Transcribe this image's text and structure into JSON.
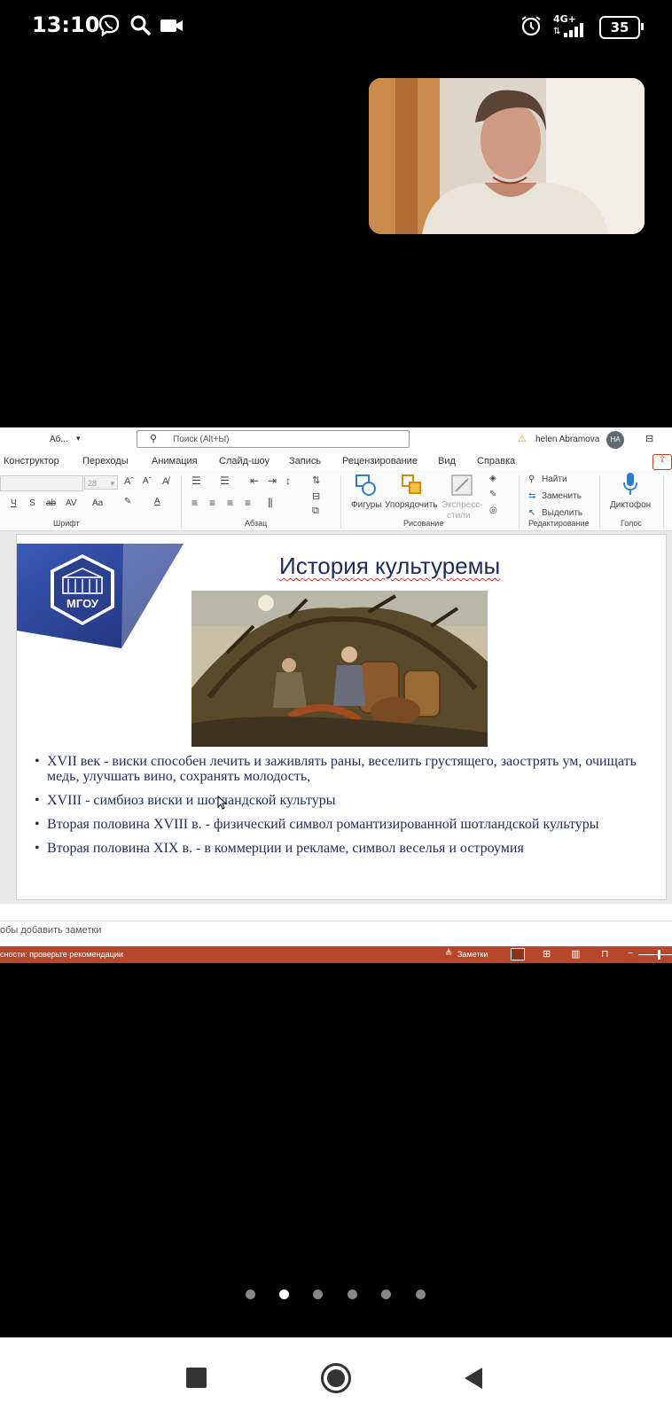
{
  "status_bar": {
    "time": "13:10",
    "network": "4G+",
    "battery": "35",
    "icons": [
      "viber-icon",
      "search-icon",
      "video-camera-icon",
      "alarm-icon",
      "signal-icon",
      "battery-icon"
    ]
  },
  "app_window": {
    "doc_name": "Аб...",
    "search_placeholder": "Поиск (Alt+Ы)",
    "user_name": "helen Abramova",
    "user_initials": "HA"
  },
  "menu_tabs": [
    "Конструктор",
    "Переходы",
    "Анимация",
    "Слайд-шоу",
    "Запись",
    "Рецензирование",
    "Вид",
    "Справка"
  ],
  "ribbon": {
    "font_size": "28",
    "groups": {
      "font": "Шрифт",
      "paragraph": "Абзац",
      "drawing": "Рисование",
      "editing": "Редактирование",
      "voice": "Голос"
    },
    "buttons": {
      "shapes": "Фигуры",
      "arrange": "Упорядочить",
      "express_styles_line1": "Экспресс-",
      "express_styles_line2": "стили",
      "find": "Найти",
      "replace": "Заменить",
      "select": "Выделить",
      "dictate": "Диктофон"
    }
  },
  "slide": {
    "title": "История культуремы",
    "logo_text": "МГОУ",
    "bullets": [
      "XVII век -  виски способен лечить и заживлять раны, веселить грустящего, заострять ум, очищать медь, улучшать вино, сохранять молодость,",
      "XVIII - симбиоз виски и шотландской культуры",
      "Вторая половина XVIII в.  - физический символ романтизированной шотландской культуры",
      "Вторая половина XIX в. - в коммерции и рекламе, символ веселья и остроумия"
    ]
  },
  "notes_placeholder": "обы добавить заметки",
  "app_status": {
    "accessibility": "сности: проверьте рекомендации",
    "notes_button": "Заметки"
  },
  "page_indicator": {
    "count": 6,
    "active_index": 1
  },
  "colors": {
    "accent_red": "#b7472a",
    "slide_text": "#1f2a5c",
    "logo_blue": "#2b3f8f"
  }
}
